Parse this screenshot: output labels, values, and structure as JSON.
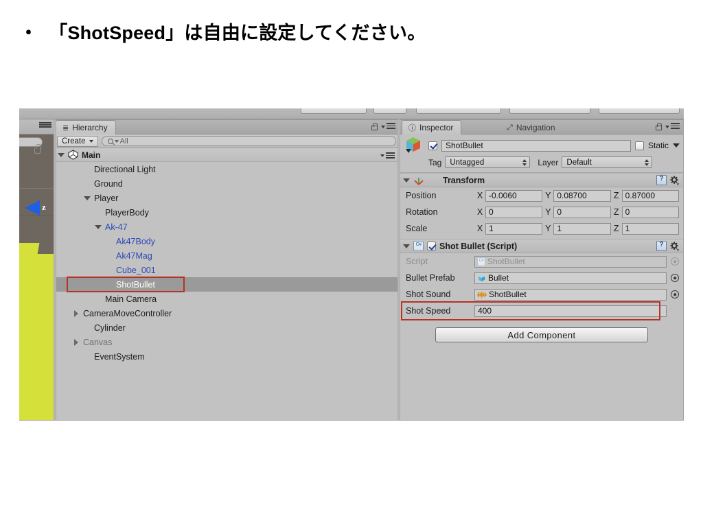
{
  "slide": {
    "bullet": "・",
    "heading": "「ShotSpeed」は自由に設定してください。"
  },
  "scene_view": {
    "gizmo_axis_label": "z"
  },
  "hierarchy": {
    "tab_label": "Hierarchy",
    "tab_icon": "hierarchy-list-icon",
    "create_label": "Create",
    "search_placeholder": "All",
    "search_icon": "search-icon",
    "lock_icon": "lock-icon",
    "menu_icon": "hamburger-menu-icon",
    "scene_name": "Main",
    "items": [
      {
        "label": "Directional Light",
        "indent": 2,
        "arrow": "none",
        "style": "normal",
        "selected": false
      },
      {
        "label": "Ground",
        "indent": 2,
        "arrow": "none",
        "style": "normal",
        "selected": false
      },
      {
        "label": "Player",
        "indent": 2,
        "arrow": "down",
        "style": "normal",
        "selected": false
      },
      {
        "label": "PlayerBody",
        "indent": 3,
        "arrow": "none",
        "style": "normal",
        "selected": false
      },
      {
        "label": "Ak-47",
        "indent": 3,
        "arrow": "down",
        "style": "prefab",
        "selected": false
      },
      {
        "label": "Ak47Body",
        "indent": 4,
        "arrow": "none",
        "style": "prefab",
        "selected": false
      },
      {
        "label": "Ak47Mag",
        "indent": 4,
        "arrow": "none",
        "style": "prefab",
        "selected": false
      },
      {
        "label": "Cube_001",
        "indent": 4,
        "arrow": "none",
        "style": "prefab",
        "selected": false
      },
      {
        "label": "ShotBullet",
        "indent": 4,
        "arrow": "none",
        "style": "normal",
        "selected": true
      },
      {
        "label": "Main Camera",
        "indent": 3,
        "arrow": "none",
        "style": "normal",
        "selected": false
      },
      {
        "label": "CameraMoveController",
        "indent": 1,
        "arrow": "right",
        "style": "normal",
        "selected": false
      },
      {
        "label": "Cylinder",
        "indent": 2,
        "arrow": "none",
        "style": "normal",
        "selected": false
      },
      {
        "label": "Canvas",
        "indent": 1,
        "arrow": "right",
        "style": "disabled",
        "selected": false
      },
      {
        "label": "EventSystem",
        "indent": 2,
        "arrow": "none",
        "style": "normal",
        "selected": false
      }
    ]
  },
  "inspector": {
    "tabs": [
      {
        "label": "Inspector",
        "icon": "info-circle-icon",
        "active": true
      },
      {
        "label": "Navigation",
        "icon": "navigation-icon",
        "active": false
      }
    ],
    "lock_icon": "lock-icon",
    "menu_icon": "hamburger-menu-icon",
    "object": {
      "icon": "prefab-cube-icon",
      "enabled": true,
      "name": "ShotBullet",
      "static_label": "Static",
      "static_checked": false,
      "tag_label": "Tag",
      "tag_value": "Untagged",
      "layer_label": "Layer",
      "layer_value": "Default"
    },
    "transform": {
      "title": "Transform",
      "icon": "transform-axis-icon",
      "help_icon": "help-book-icon",
      "gear_icon": "gear-icon",
      "rows": [
        {
          "label": "Position",
          "x": "-0.0060",
          "y": "0.08700",
          "z": "0.87000"
        },
        {
          "label": "Rotation",
          "x": "0",
          "y": "0",
          "z": "0"
        },
        {
          "label": "Scale",
          "x": "1",
          "y": "1",
          "z": "1"
        }
      ],
      "axis_labels": [
        "X",
        "Y",
        "Z"
      ]
    },
    "script_component": {
      "title": "Shot Bullet (Script)",
      "icon": "csharp-script-icon",
      "enabled": true,
      "help_icon": "help-book-icon",
      "gear_icon": "gear-icon",
      "fields": [
        {
          "label": "Script",
          "value": "ShotBullet",
          "kind": "object",
          "icon": "csharp-script-icon",
          "readonly": true
        },
        {
          "label": "Bullet Prefab",
          "value": "Bullet",
          "kind": "object",
          "icon": "prefab-cube-icon",
          "readonly": false
        },
        {
          "label": "Shot Sound",
          "value": "ShotBullet",
          "kind": "object",
          "icon": "audio-clip-icon",
          "readonly": false
        },
        {
          "label": "Shot Speed",
          "value": "400",
          "kind": "number",
          "icon": "",
          "readonly": false
        }
      ]
    },
    "add_component_label": "Add Component"
  },
  "annotations": {
    "highlight_color": "#b53225",
    "targets": [
      "hierarchy-shotbullet-row",
      "inspector-shot-speed-row"
    ]
  }
}
